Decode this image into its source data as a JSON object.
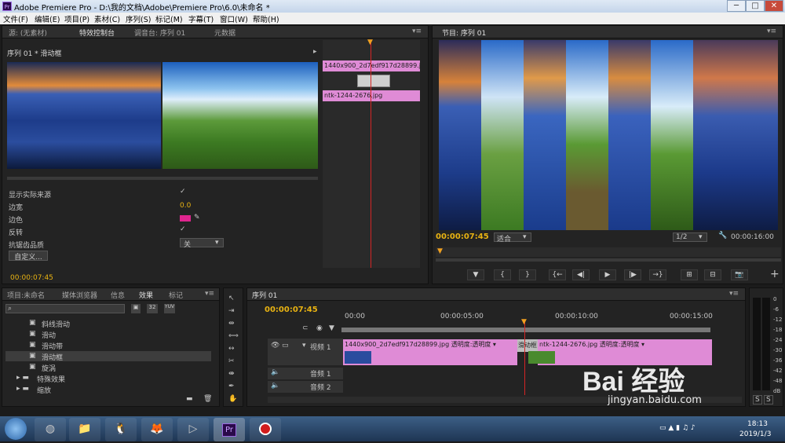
{
  "window": {
    "title": "Adobe Premiere Pro - D:\\我的文档\\Adobe\\Premiere Pro\\6.0\\未命名 *",
    "app_icon": "Pr",
    "min": "─",
    "max": "□",
    "close": "✕"
  },
  "menu": [
    "文件(F)",
    "编辑(E)",
    "项目(P)",
    "素材(C)",
    "序列(S)",
    "标记(M)",
    "字幕(T)",
    "窗口(W)",
    "帮助(H)"
  ],
  "effect_panel": {
    "tabs": [
      "源: (无素材)",
      "特效控制台",
      "调音台: 序列 01",
      "元数据"
    ],
    "header": "序列 01 * 滑动框",
    "clip_a": "1440x900_2d7edf917d28899.jpg",
    "clip_b": "ntk-1244-2676.jpg",
    "props": [
      {
        "label": "显示实际来源",
        "value": "✓"
      },
      {
        "label": "边宽",
        "value": "0.0"
      },
      {
        "label": "边色",
        "value": ""
      },
      {
        "label": "反转",
        "value": "✓"
      },
      {
        "label": "抗锯齿品质",
        "value": "关"
      }
    ],
    "custom_button": "自定义...",
    "timecode": "00:00:07:45",
    "border_color": "#e0258f"
  },
  "program": {
    "tab": "节目: 序列 01",
    "timecode": "00:00:07:45",
    "fit": "适合",
    "ratio": "1/2",
    "duration": "00:00:16:00",
    "buttons": [
      "▼",
      "{",
      "}",
      "{←",
      "◀|",
      "▶",
      "|▶",
      "→}",
      "⊞",
      "⊟",
      "📷"
    ],
    "add": "+"
  },
  "project": {
    "tabs": [
      "项目:未命名",
      "媒体浏览器",
      "信息",
      "效果",
      "标记"
    ],
    "items": [
      {
        "label": "斜线滑动",
        "indent": 2
      },
      {
        "label": "滑动",
        "indent": 2
      },
      {
        "label": "滑动带",
        "indent": 2
      },
      {
        "label": "滑动框",
        "indent": 2,
        "selected": true
      },
      {
        "label": "旋涡",
        "indent": 2
      },
      {
        "label": "特殊效果",
        "indent": 1
      },
      {
        "label": "缩放",
        "indent": 1
      }
    ]
  },
  "timeline": {
    "tab": "序列 01",
    "timecode": "00:00:07:45",
    "ruler": [
      "00:00",
      "00:00:05:00",
      "00:00:10:00",
      "00:00:15:00"
    ],
    "tracks": [
      "视频 1",
      "音频 1",
      "音频 2"
    ],
    "clip1": "1440x900_2d7edf917d28899.jpg  透明度:透明度 ▾",
    "transition": "滑动框",
    "clip2": "ntk-1244-2676.jpg  透明度:透明度 ▾"
  },
  "meter": {
    "labels": [
      "0",
      "-6",
      "-12",
      "-18",
      "-24",
      "-30",
      "-36",
      "-42",
      "-48",
      "dB"
    ],
    "solo": "S"
  },
  "taskbar": {
    "time": "18:13",
    "date": "2019/1/3"
  },
  "watermark": {
    "logo": "Bai 经验",
    "url": "jingyan.baidu.com"
  }
}
